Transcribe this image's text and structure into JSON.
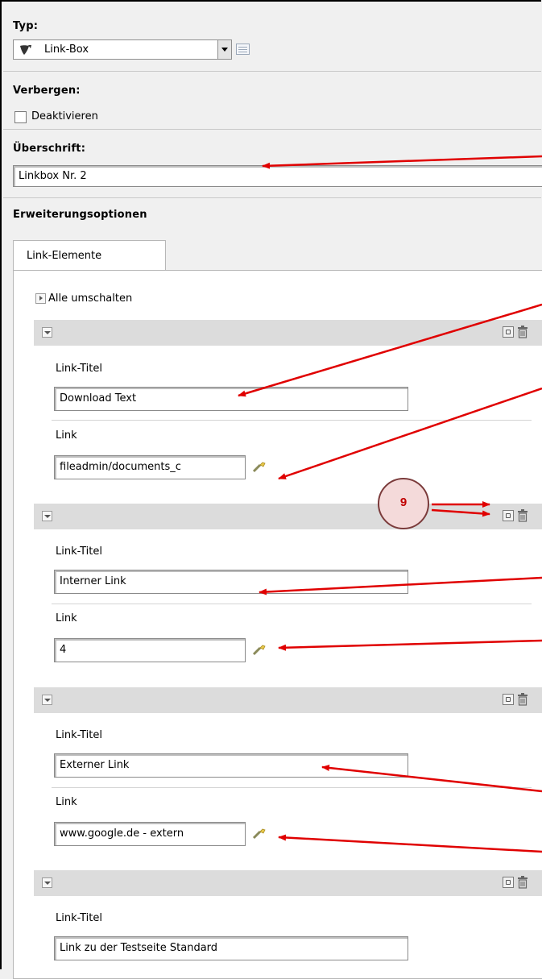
{
  "type_section": {
    "label": "Typ:",
    "selected": "Link-Box"
  },
  "hide_section": {
    "label": "Verbergen:",
    "checkbox_label": "Deaktivieren",
    "checked": false
  },
  "heading_section": {
    "label": "Überschrift:",
    "value": "Linkbox Nr. 2"
  },
  "extension_section": {
    "label": "Erweiterungsoptionen"
  },
  "tab": {
    "label": "Link-Elemente"
  },
  "toggle_all": {
    "label": "Alle umschalten"
  },
  "items": [
    {
      "title_label": "Link-Titel",
      "title_value": "Download Text",
      "link_label": "Link",
      "link_value": "fileadmin/documents_c"
    },
    {
      "title_label": "Link-Titel",
      "title_value": "Interner Link",
      "link_label": "Link",
      "link_value": "4"
    },
    {
      "title_label": "Link-Titel",
      "title_value": "Externer Link",
      "link_label": "Link",
      "link_value": "www.google.de - extern"
    },
    {
      "title_label": "Link-Titel",
      "title_value": "Link zu der Testseite Standard"
    }
  ],
  "callout": {
    "number": "9"
  },
  "icons": [
    "typo3-logo-icon",
    "chevron-down-icon",
    "edit-list-icon",
    "expand-icon",
    "collapse-icon",
    "move-icon",
    "trash-icon",
    "wizard-wand-icon"
  ],
  "colors": {
    "annotation": "#e00000",
    "header_bg": "#dcdcdc",
    "page_bg": "#f0f0f0"
  }
}
